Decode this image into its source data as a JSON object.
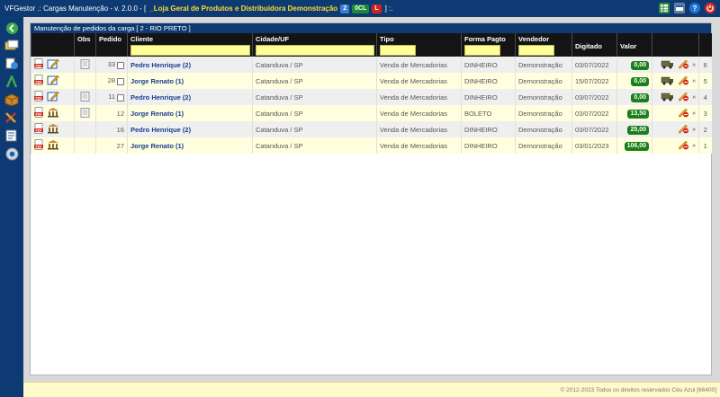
{
  "topbar": {
    "app_title": "VFGestor .: Cargas Manutenção - v. 2.0.0 - [",
    "company": "_Loja Geral de Produtos e Distribuidora Demonstração",
    "badges": [
      {
        "text": "2",
        "bg": "#3a7fd0",
        "fg": "#ffffff"
      },
      {
        "text": "0CL",
        "bg": "#1a8a3a",
        "fg": "#ffffff"
      },
      {
        "text": "L",
        "bg": "#cc2222",
        "fg": "#ffffff"
      }
    ],
    "suffix": "] :.",
    "icons": [
      "spreadsheet-icon",
      "window-icon",
      "help-icon",
      "power-icon"
    ]
  },
  "sidebar": {
    "items": [
      "back-icon",
      "tickets-icon",
      "documents-icon",
      "route-icon",
      "box-icon",
      "tools-icon",
      "report-icon",
      "settings-icon"
    ]
  },
  "panel": {
    "title": "Manutenção de pedidos da carga [ 2 - RIO PRETO ]"
  },
  "table": {
    "headers": {
      "actions": "",
      "obs": "Obs",
      "pedido": "Pedido",
      "cliente": "Cliente",
      "cidade": "Cidade/UF",
      "tipo": "Tipo",
      "forma": "Forma Pagto",
      "vendedor": "Vendedor",
      "digitado": "Digitado",
      "valor": "Valor",
      "ops": "",
      "seq": ""
    },
    "rows": [
      {
        "pedido": "33",
        "has_obs": true,
        "has_check": true,
        "cliente": "Pedro Henrique (2)",
        "cidade": "Catanduva / SP",
        "tipo": "Venda de Mercadorias",
        "forma": "DINHEIRO",
        "vendedor": "Demonstração",
        "digitado": "03/07/2022",
        "valor": "0,00",
        "has_truck": true,
        "seq": "6",
        "row_icon": "edit"
      },
      {
        "pedido": "28",
        "has_obs": false,
        "has_check": true,
        "cliente": "Jorge Renato (1)",
        "cidade": "Catanduva / SP",
        "tipo": "Venda de Mercadorias",
        "forma": "DINHEIRO",
        "vendedor": "Demonstração",
        "digitado": "15/07/2022",
        "valor": "0,00",
        "has_truck": true,
        "seq": "5",
        "row_icon": "edit"
      },
      {
        "pedido": "11",
        "has_obs": true,
        "has_check": true,
        "cliente": "Pedro Henrique (2)",
        "cidade": "Catanduva / SP",
        "tipo": "Venda de Mercadorias",
        "forma": "DINHEIRO",
        "vendedor": "Demonstração",
        "digitado": "03/07/2022",
        "valor": "0,00",
        "has_truck": true,
        "seq": "4",
        "row_icon": "edit"
      },
      {
        "pedido": "12",
        "has_obs": true,
        "has_check": false,
        "cliente": "Jorge Renato (1)",
        "cidade": "Catanduva / SP",
        "tipo": "Venda de Mercadorias",
        "forma": "BOLETO",
        "vendedor": "Demonstração",
        "digitado": "03/07/2022",
        "valor": "13,50",
        "has_truck": false,
        "seq": "3",
        "row_icon": "bank"
      },
      {
        "pedido": "16",
        "has_obs": false,
        "has_check": false,
        "cliente": "Pedro Henrique (2)",
        "cidade": "Catanduva / SP",
        "tipo": "Venda de Mercadorias",
        "forma": "DINHEIRO",
        "vendedor": "Demonstração",
        "digitado": "03/07/2022",
        "valor": "25,00",
        "has_truck": false,
        "seq": "2",
        "row_icon": "bank"
      },
      {
        "pedido": "27",
        "has_obs": false,
        "has_check": false,
        "cliente": "Jorge Renato (1)",
        "cidade": "Catanduva / SP",
        "tipo": "Venda de Mercadorias",
        "forma": "DINHEIRO",
        "vendedor": "Demonstração",
        "digitado": "03/01/2023",
        "valor": "106,00",
        "has_truck": false,
        "seq": "1",
        "row_icon": "bank"
      }
    ]
  },
  "footer": {
    "text": "© 2012-2023 Todos os direitos reservados Céu Azul [66400]"
  },
  "colors": {
    "header_bg": "#0e3a73",
    "value_badge": "#1a7f1a",
    "filter_input": "#ffff99"
  }
}
